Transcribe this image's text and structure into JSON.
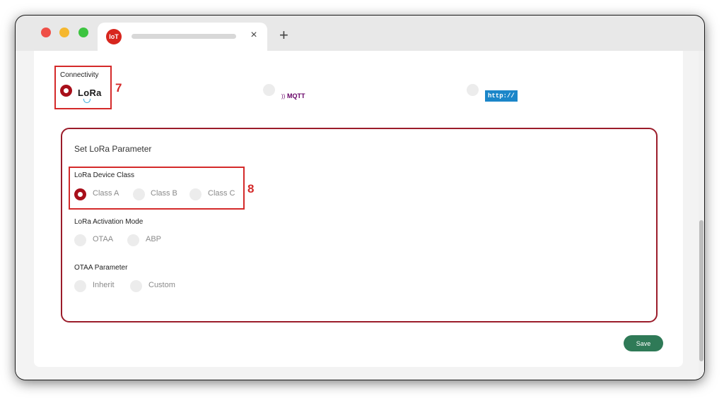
{
  "browser": {
    "tab_icon_text": "IoT",
    "tab_close_glyph": "×",
    "new_tab_glyph": "+"
  },
  "connectivity": {
    "label": "Connectivity",
    "step": "7",
    "options": [
      {
        "name": "LoRa",
        "logo_text": "LoRa",
        "selected": true
      },
      {
        "name": "MQTT",
        "logo_text": "MQTT",
        "selected": false
      },
      {
        "name": "HTTP",
        "logo_text": "http://",
        "selected": false
      }
    ]
  },
  "lora_params": {
    "title": "Set LoRa Parameter",
    "device_class": {
      "label": "LoRa Device Class",
      "step": "8",
      "options": [
        "Class A",
        "Class B",
        "Class C"
      ],
      "selected": "Class A"
    },
    "activation_mode": {
      "label": "LoRa Activation Mode",
      "options": [
        "OTAA",
        "ABP"
      ],
      "selected": null
    },
    "otaa_parameter": {
      "label": "OTAA Parameter",
      "options": [
        "Inherit",
        "Custom"
      ],
      "selected": null
    }
  },
  "actions": {
    "save_label": "Save"
  },
  "colors": {
    "accent_red": "#a80f1a",
    "highlight_red": "#d42a2a",
    "save_green": "#2f7a57",
    "http_blue": "#1b86c9",
    "mqtt_purple": "#660066"
  }
}
